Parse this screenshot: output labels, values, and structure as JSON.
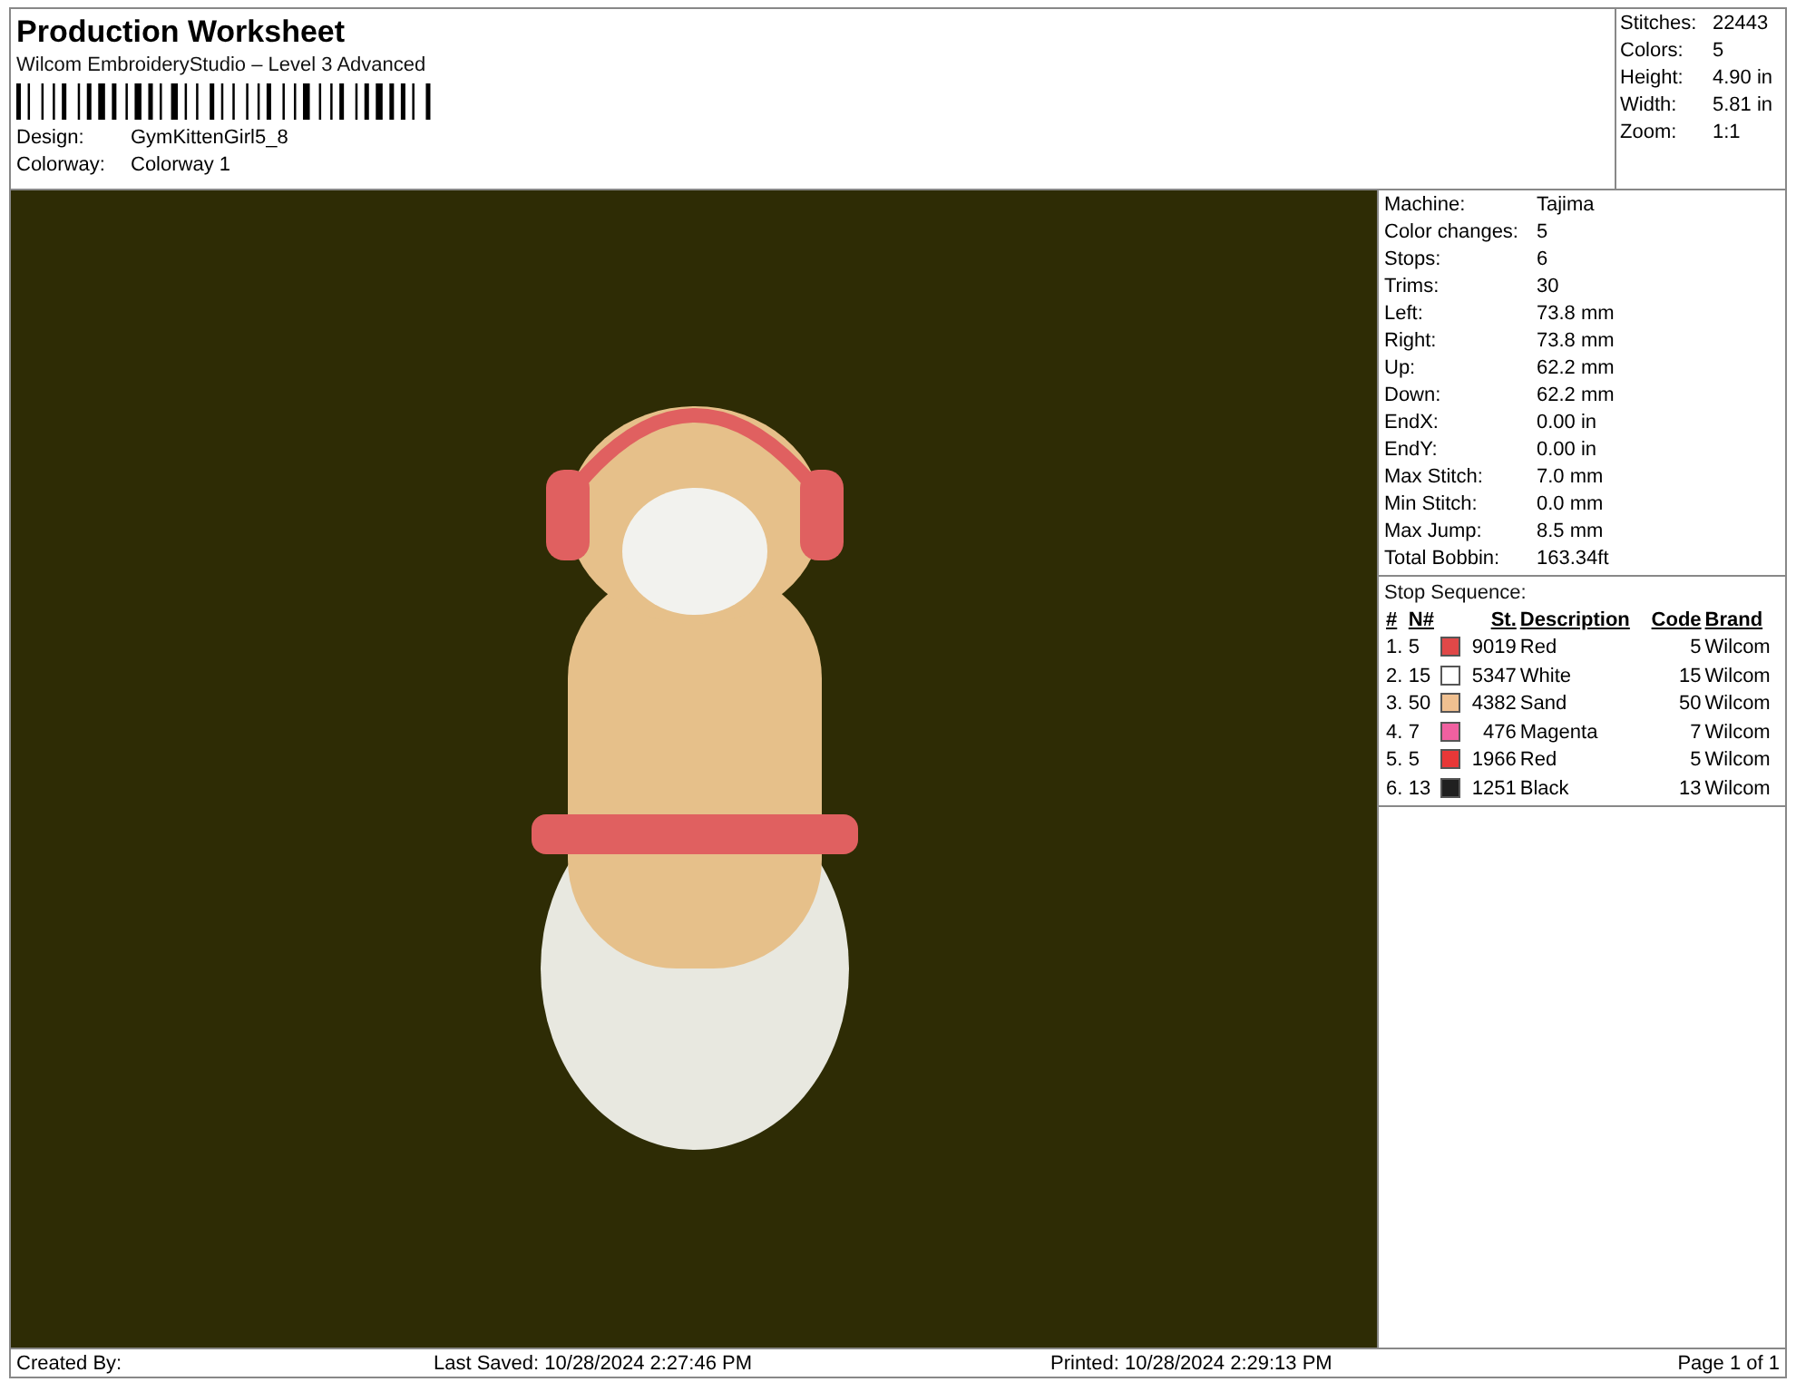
{
  "header": {
    "title": "Production Worksheet",
    "software": "Wilcom EmbroideryStudio – Level 3 Advanced",
    "fields": [
      {
        "label": "Design:",
        "value": "GymKittenGirl5_8"
      },
      {
        "label": "Colorway:",
        "value": "Colorway 1"
      }
    ]
  },
  "summary": [
    {
      "label": "Stitches:",
      "value": "22443"
    },
    {
      "label": "Colors:",
      "value": "5"
    },
    {
      "label": "Height:",
      "value": "4.90 in"
    },
    {
      "label": "Width:",
      "value": "5.81 in"
    },
    {
      "label": "Zoom:",
      "value": "1:1"
    }
  ],
  "details": [
    {
      "label": "Machine:",
      "value": "Tajima"
    },
    {
      "label": "Color changes:",
      "value": "5"
    },
    {
      "label": "Stops:",
      "value": "6"
    },
    {
      "label": "Trims:",
      "value": "30"
    },
    {
      "label": "Left:",
      "value": "73.8 mm"
    },
    {
      "label": "Right:",
      "value": "73.8 mm"
    },
    {
      "label": "Up:",
      "value": "62.2 mm"
    },
    {
      "label": "Down:",
      "value": "62.2 mm"
    },
    {
      "label": "EndX:",
      "value": "0.00 in"
    },
    {
      "label": "EndY:",
      "value": "0.00 in"
    },
    {
      "label": "Max Stitch:",
      "value": "7.0 mm"
    },
    {
      "label": "Min Stitch:",
      "value": "0.0 mm"
    },
    {
      "label": "Max Jump:",
      "value": "8.5 mm"
    },
    {
      "label": "Total Bobbin:",
      "value": "163.34ft"
    }
  ],
  "stop_sequence": {
    "title": "Stop Sequence:",
    "columns": [
      "#",
      "N#",
      "St.",
      "Description",
      "Code",
      "Brand"
    ],
    "rows": [
      {
        "index": "1.",
        "needle": "5",
        "color": "#e04848",
        "stitches": "9019",
        "description": "Red",
        "code": "5",
        "brand": "Wilcom"
      },
      {
        "index": "2.",
        "needle": "15",
        "color": "#ffffff",
        "stitches": "5347",
        "description": "White",
        "code": "15",
        "brand": "Wilcom"
      },
      {
        "index": "3.",
        "needle": "50",
        "color": "#f0c090",
        "stitches": "4382",
        "description": "Sand",
        "code": "50",
        "brand": "Wilcom"
      },
      {
        "index": "4.",
        "needle": "7",
        "color": "#f060a0",
        "stitches": "476",
        "description": "Magenta",
        "code": "7",
        "brand": "Wilcom"
      },
      {
        "index": "5.",
        "needle": "5",
        "color": "#e83838",
        "stitches": "1966",
        "description": "Red",
        "code": "5",
        "brand": "Wilcom"
      },
      {
        "index": "6.",
        "needle": "13",
        "color": "#202020",
        "stitches": "1251",
        "description": "Black",
        "code": "13",
        "brand": "Wilcom"
      }
    ]
  },
  "footer": {
    "created_by": "Created By:",
    "last_saved": "Last Saved: 10/28/2024 2:27:46 PM",
    "printed": "Printed: 10/28/2024 2:29:13 PM",
    "page": "Page 1 of 1"
  }
}
